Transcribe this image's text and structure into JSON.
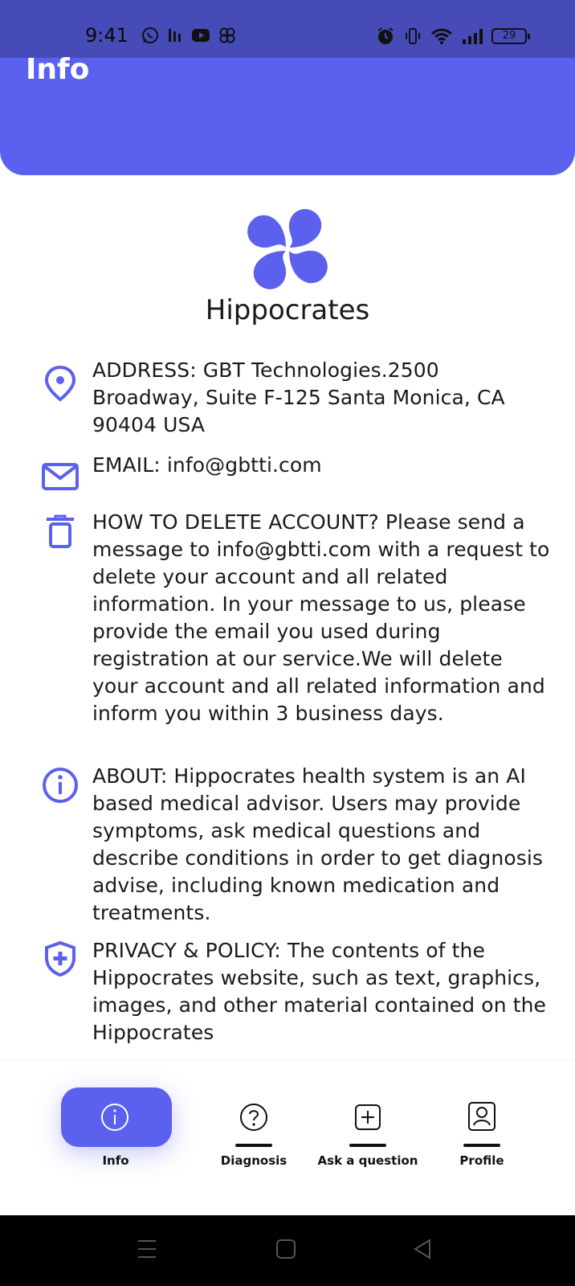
{
  "status_bar": {
    "time": "9:41",
    "battery": "29",
    "left_icons": [
      "whatsapp-icon",
      "signal-speed-icon",
      "youtube-icon",
      "pinwheel-icon"
    ],
    "right_icons": [
      "alarm-icon",
      "vibrate-icon",
      "wifi-icon",
      "cell-signal-icon"
    ]
  },
  "header": {
    "title": "Info",
    "color": "#5b61ee"
  },
  "app": {
    "name": "Hippocrates",
    "logo_icon": "pinwheel-logo-icon",
    "accent": "#5b61ee"
  },
  "info": {
    "address": "ADDRESS: GBT Technologies.2500 Broadway, Suite F-125 Santa Monica, CA 90404 USA",
    "email": "EMAIL: info@gbtti.com",
    "delete_account": "HOW TO DELETE ACCOUNT? Please send a message to info@gbtti.com with a request to delete your account and all related information. In your message to us, please provide the email you used during registration at our service.We will delete your account and all related information and inform you within 3 business days.",
    "about": "ABOUT: Hippocrates health system is an AI based medical advisor. Users may provide symptoms, ask medical questions and describe conditions in order to get diagnosis advise, including known medication and treatments.",
    "privacy": "PRIVACY & POLICY: The contents of the Hippocrates website, such as text, graphics, images, and other material contained on the Hippocrates"
  },
  "nav": {
    "items": [
      {
        "label": "Info",
        "icon": "info-icon",
        "active": true
      },
      {
        "label": "Diagnosis",
        "icon": "question-icon",
        "active": false
      },
      {
        "label": "Ask a question",
        "icon": "plus-square-icon",
        "active": false
      },
      {
        "label": "Profile",
        "icon": "profile-icon",
        "active": false
      }
    ]
  },
  "system_nav": [
    "menu-icon",
    "home-icon",
    "back-icon"
  ]
}
